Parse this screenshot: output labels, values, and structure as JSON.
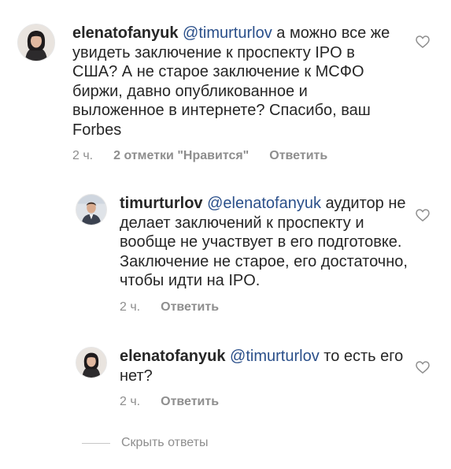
{
  "comments": [
    {
      "username": "elenatofanyuk",
      "mention": "@timurturlov",
      "text": " а можно все же увидеть заключение к проспекту IPO в США? А не старое заключение к МСФО биржи, давно опубликованное и выложенное в интернете? Спасибо, ваш Forbes",
      "time": "2 ч.",
      "likes": "2 отметки \"Нравится\"",
      "reply_label": "Ответить",
      "avatar_icon": "female-avatar",
      "like_icon": "heart-outline-icon"
    },
    {
      "username": "timurturlov",
      "mention": "@elenatofanyuk",
      "text": " аудитор не делает заключений к проспекту и вообще не участвует в его подготовке. Заключение не старое, его достаточно, чтобы идти на IPO.",
      "time": "2 ч.",
      "reply_label": "Ответить",
      "avatar_icon": "male-avatar",
      "like_icon": "heart-outline-icon"
    },
    {
      "username": "elenatofanyuk",
      "mention": "@timurturlov",
      "text": " то есть его нет?",
      "time": "2 ч.",
      "reply_label": "Ответить",
      "avatar_icon": "female-avatar",
      "like_icon": "heart-outline-icon"
    }
  ],
  "hide_replies_label": "Скрыть ответы",
  "colors": {
    "text": "#262626",
    "mention": "#2a4f8a",
    "meta": "#8e8e8e"
  }
}
